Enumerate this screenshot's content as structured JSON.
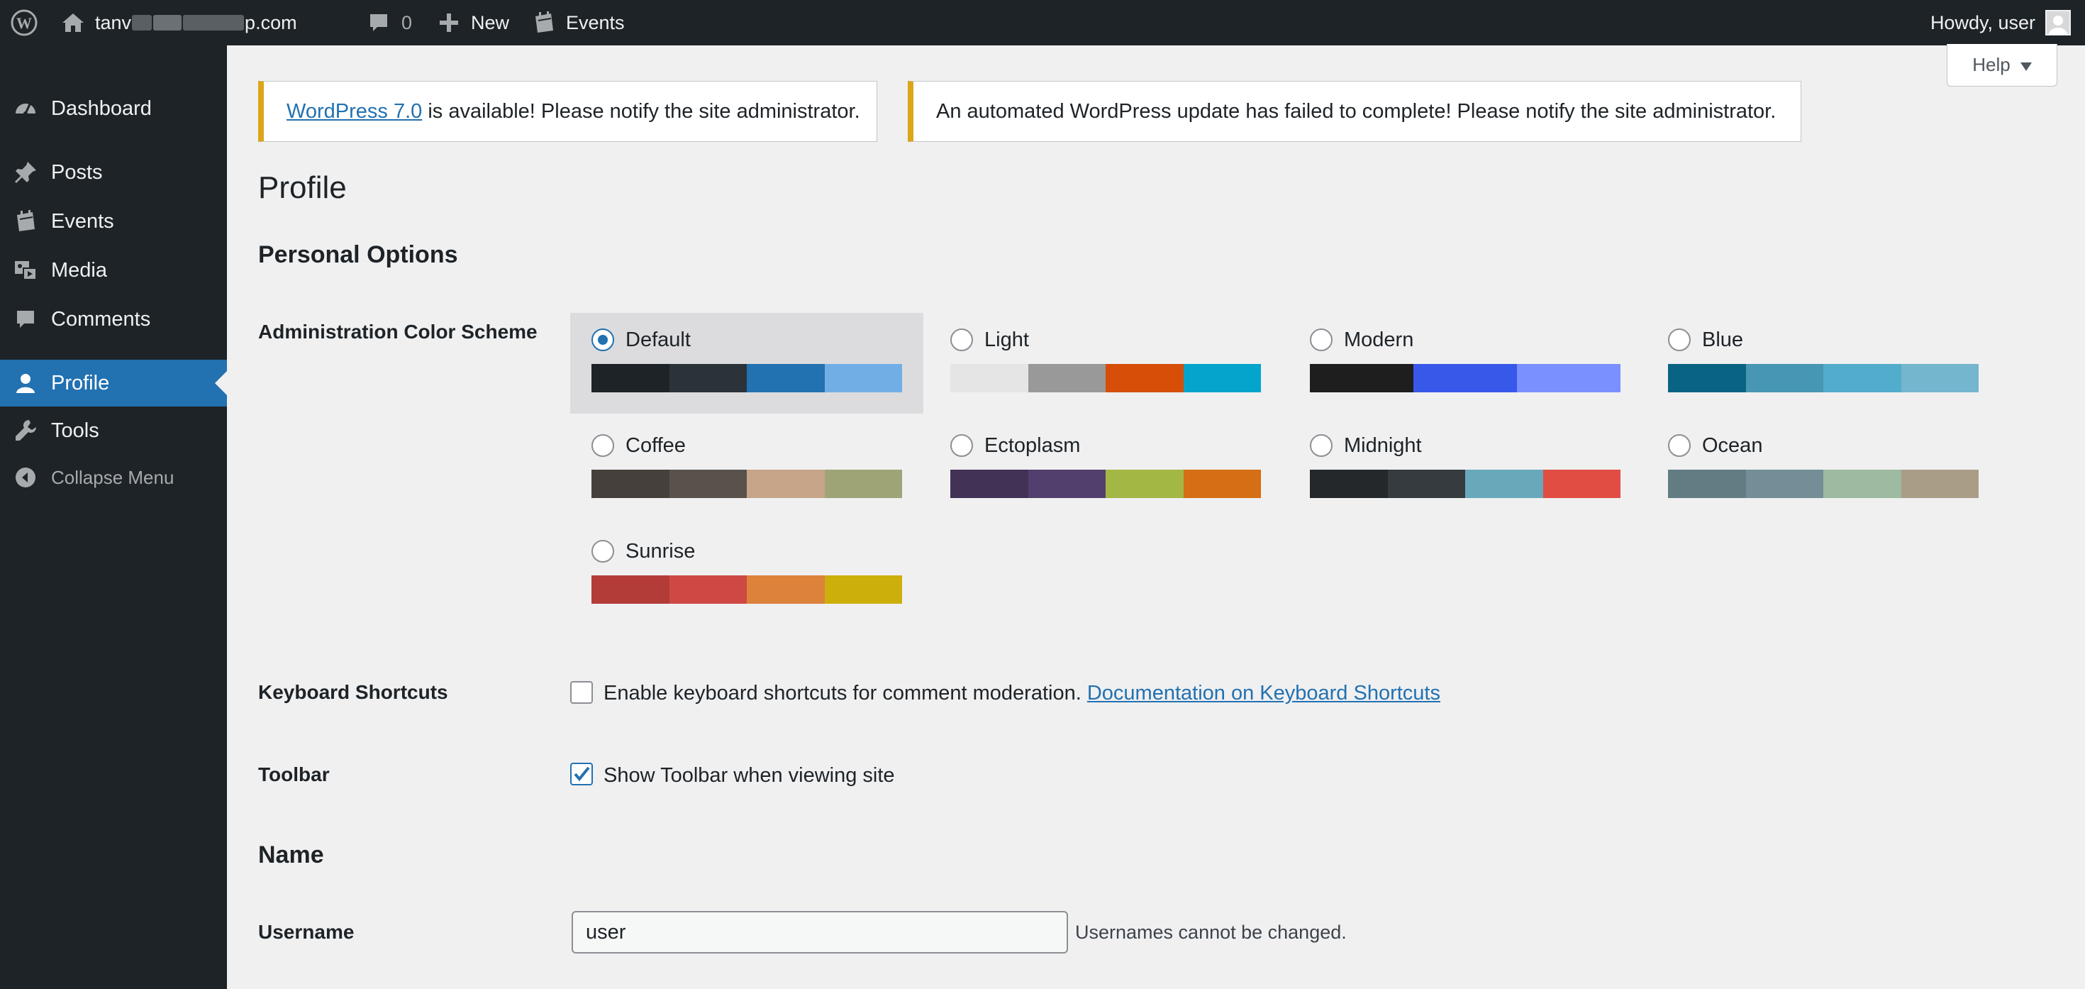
{
  "adminbar": {
    "site_name_prefix": "tanv",
    "site_name_suffix": "p.com",
    "comments_count": "0",
    "new_label": "New",
    "events_label": "Events",
    "howdy": "Howdy, user"
  },
  "sidebar": {
    "items": [
      {
        "label": "Dashboard",
        "icon": "dashboard-icon"
      },
      {
        "label": "Posts",
        "icon": "pin-icon"
      },
      {
        "label": "Events",
        "icon": "calendar-icon"
      },
      {
        "label": "Media",
        "icon": "media-icon"
      },
      {
        "label": "Comments",
        "icon": "comment-icon"
      },
      {
        "label": "Profile",
        "icon": "user-icon",
        "current": true
      },
      {
        "label": "Tools",
        "icon": "wrench-icon"
      },
      {
        "label": "Collapse Menu",
        "icon": "collapse-icon"
      }
    ]
  },
  "help": {
    "label": "Help"
  },
  "notices": {
    "update_link": "WordPress 7.0",
    "update_text": " is available! Please notify the site administrator.",
    "failed_text": "An automated WordPress update has failed to complete! Please notify the site administrator."
  },
  "page": {
    "title": "Profile",
    "personal_options": "Personal Options",
    "color_scheme_label": "Administration Color Scheme",
    "keyboard_label": "Keyboard Shortcuts",
    "keyboard_text": "Enable keyboard shortcuts for comment moderation.",
    "keyboard_link": "Documentation on Keyboard Shortcuts",
    "toolbar_label": "Toolbar",
    "toolbar_text": "Show Toolbar when viewing site",
    "name_section": "Name",
    "username_label": "Username",
    "username_value": "user",
    "username_desc": "Usernames cannot be changed."
  },
  "schemes": [
    {
      "name": "Default",
      "selected": true,
      "colors": [
        "#1d2327",
        "#2c3338",
        "#2271b1",
        "#72aee6"
      ]
    },
    {
      "name": "Light",
      "selected": false,
      "colors": [
        "#e5e5e5",
        "#999999",
        "#d64e07",
        "#04a4cc"
      ]
    },
    {
      "name": "Modern",
      "selected": false,
      "colors": [
        "#1e1e1e",
        "#3858e9",
        "#7b90ff"
      ]
    },
    {
      "name": "Blue",
      "selected": false,
      "colors": [
        "#096484",
        "#4796b3",
        "#52accc",
        "#74b6ce"
      ]
    },
    {
      "name": "Coffee",
      "selected": false,
      "colors": [
        "#46403c",
        "#59524c",
        "#c7a589",
        "#9ea476"
      ]
    },
    {
      "name": "Ectoplasm",
      "selected": false,
      "colors": [
        "#413256",
        "#523f6d",
        "#a3b745",
        "#d46f15"
      ]
    },
    {
      "name": "Midnight",
      "selected": false,
      "colors": [
        "#25282b",
        "#363b3f",
        "#69a8bb",
        "#e14d43"
      ]
    },
    {
      "name": "Ocean",
      "selected": false,
      "colors": [
        "#627c83",
        "#738e96",
        "#9ebaa0",
        "#aa9d88"
      ]
    },
    {
      "name": "Sunrise",
      "selected": false,
      "colors": [
        "#b43c38",
        "#cf4944",
        "#dd823b",
        "#ccaf0b"
      ]
    }
  ],
  "checkboxes": {
    "keyboard_checked": false,
    "toolbar_checked": true
  }
}
